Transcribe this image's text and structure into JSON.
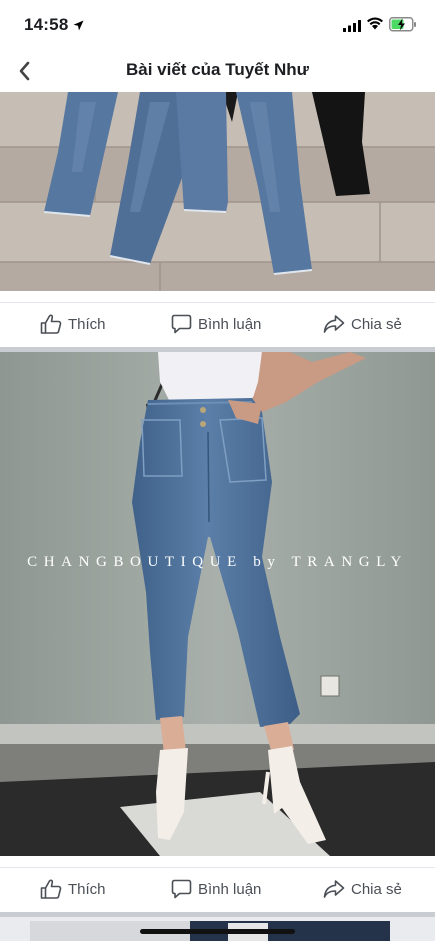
{
  "status_bar": {
    "time": "14:58",
    "icons": [
      "location-arrow-icon",
      "signal-icon",
      "wifi-icon",
      "battery-charging-icon"
    ],
    "battery_color": "#4cd964"
  },
  "nav": {
    "back_icon": "chevron-left-icon",
    "title": "Bài viết của Tuyết Như"
  },
  "posts": [
    {
      "photo": "flat-lay jeans on wooden floor",
      "actions": {
        "like": "Thích",
        "comment": "Bình luận",
        "share": "Chia sẻ"
      }
    },
    {
      "photo": "model wearing high-waist skinny jeans",
      "watermark": "CHANGBOUTIQUE by TRANGLY",
      "actions": {
        "like": "Thích",
        "comment": "Bình luận",
        "share": "Chia sẻ"
      }
    }
  ],
  "colors": {
    "action_text": "#4b4f56",
    "divider": "#c9ccd1",
    "denim": "#4a6d95"
  }
}
